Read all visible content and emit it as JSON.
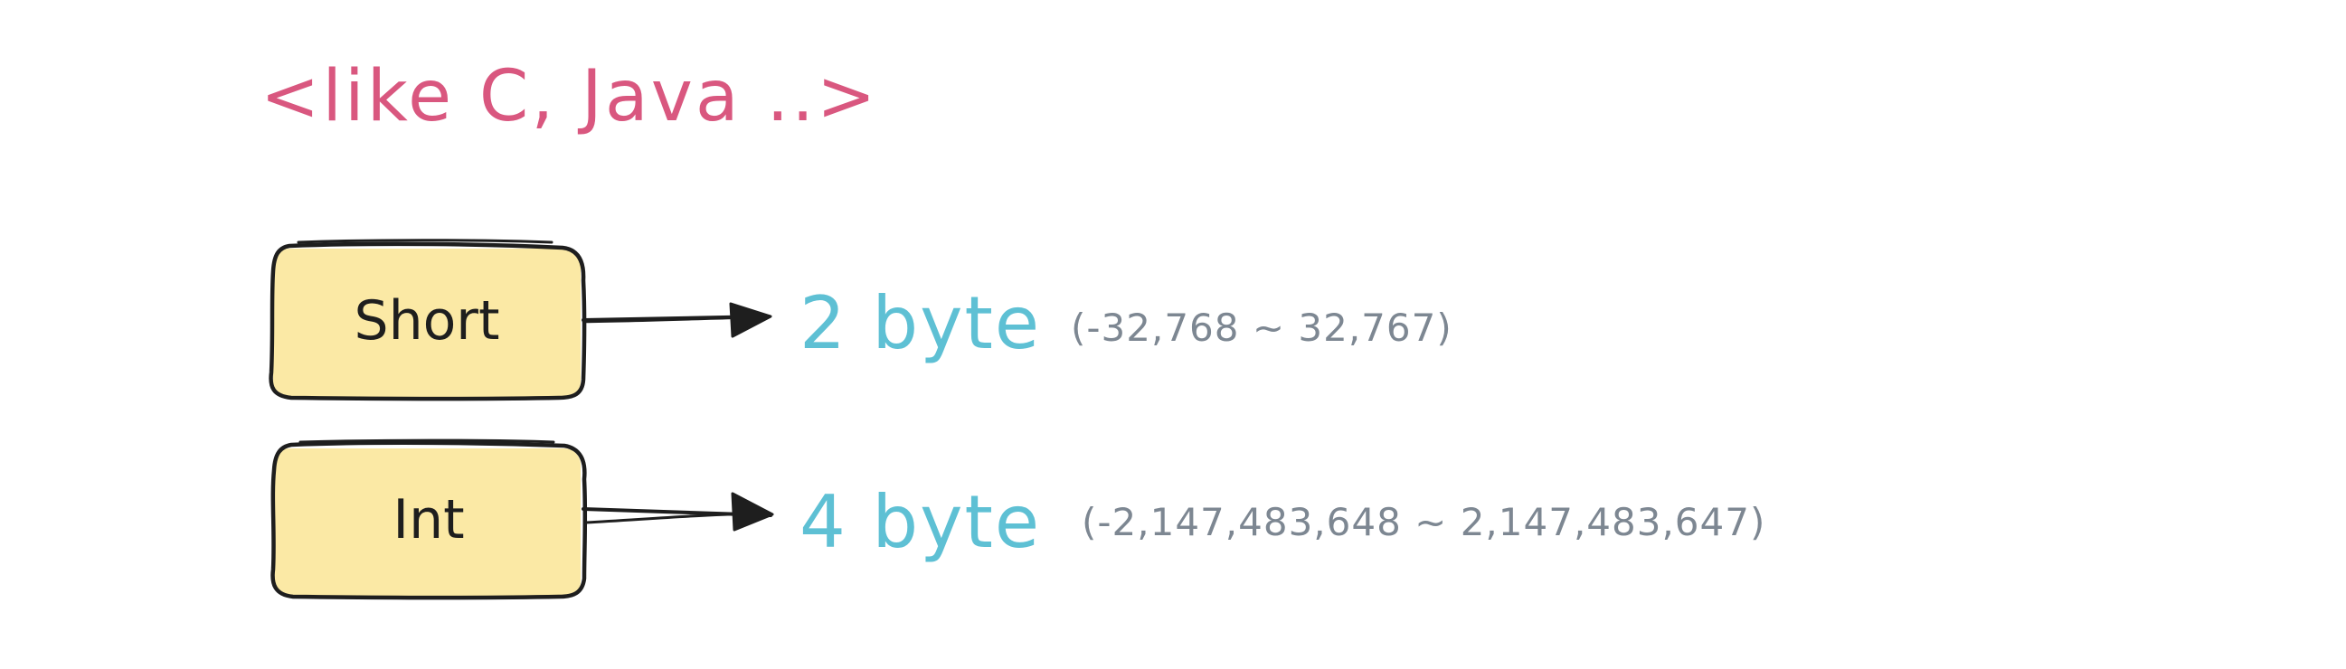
{
  "title": "<like C, Java ..>",
  "colors": {
    "title": "#d9577f",
    "box_fill": "#fbe9a5",
    "box_stroke": "#1e1e1e",
    "size_text": "#5ec0d4",
    "range_text": "#7d8792"
  },
  "types": [
    {
      "name": "Short",
      "size": "2 byte",
      "range": "(-32,768 ~ 32,767)"
    },
    {
      "name": "Int",
      "size": "4 byte",
      "range": "(-2,147,483,648 ~ 2,147,483,647)"
    }
  ]
}
